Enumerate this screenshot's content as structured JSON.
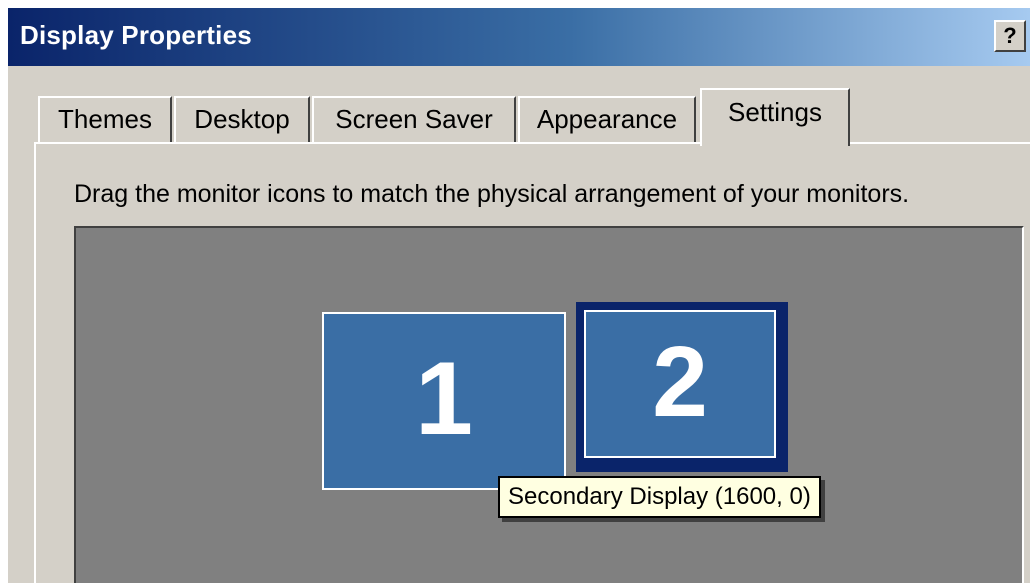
{
  "window": {
    "title": "Display Properties",
    "help_label": "?"
  },
  "tabs": [
    {
      "label": "Themes",
      "active": false
    },
    {
      "label": "Desktop",
      "active": false
    },
    {
      "label": "Screen Saver",
      "active": false
    },
    {
      "label": "Appearance",
      "active": false
    },
    {
      "label": "Settings",
      "active": true
    }
  ],
  "settings": {
    "instruction": "Drag the monitor icons to match the physical arrangement of your monitors.",
    "monitors": [
      {
        "number": "1",
        "selected": false
      },
      {
        "number": "2",
        "selected": true
      }
    ],
    "tooltip": "Secondary Display (1600, 0)"
  },
  "colors": {
    "titlebar_start": "#0a246a",
    "titlebar_end": "#a6caf0",
    "monitor_fill": "#3a6ea5",
    "monitor_area": "#808080",
    "selection_border": "#0a246a",
    "tooltip_bg": "#ffffe1"
  }
}
